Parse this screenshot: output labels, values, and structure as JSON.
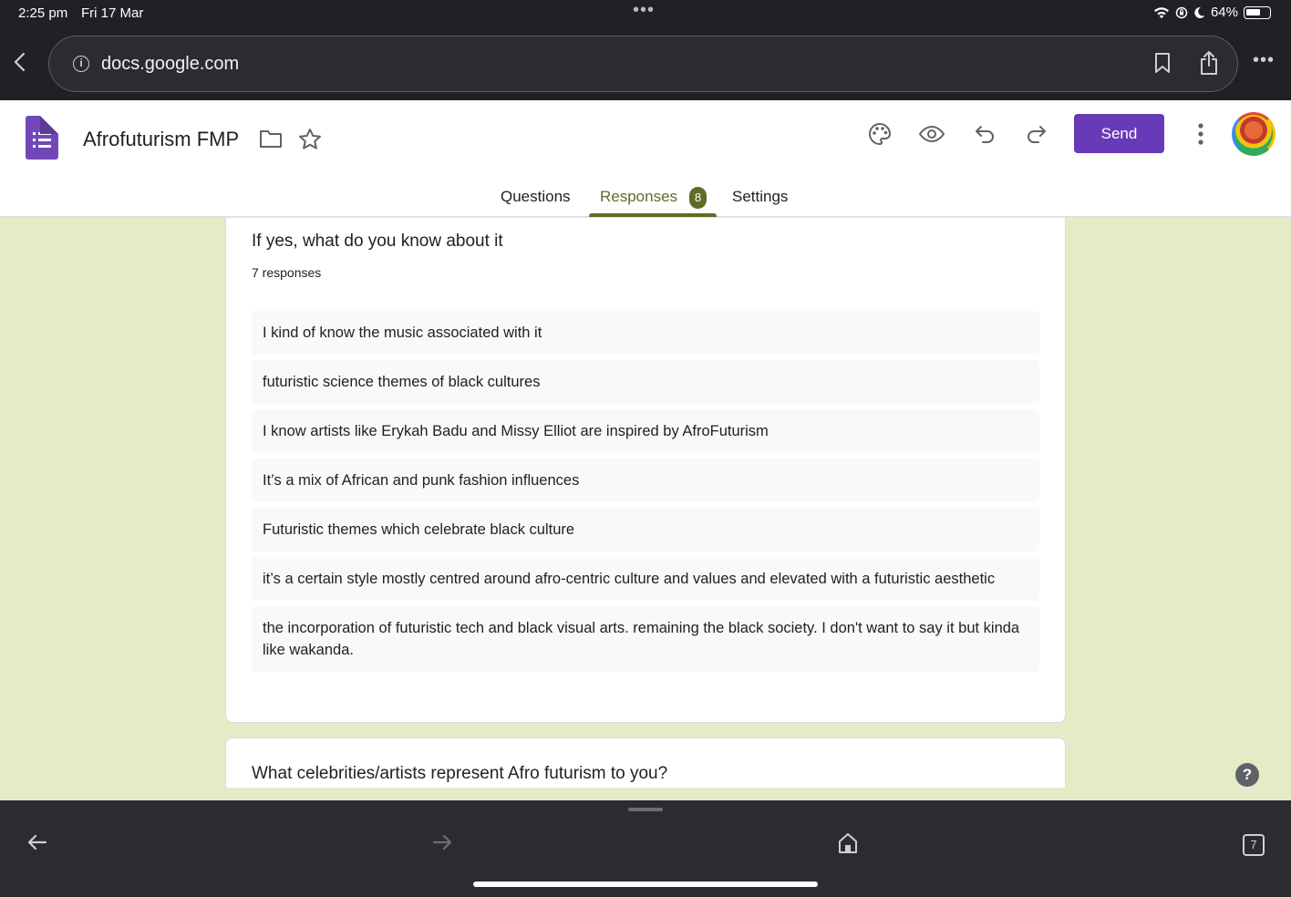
{
  "status": {
    "time": "2:25 pm",
    "date": "Fri 17 Mar",
    "battery": "64%",
    "battery_level": 0.64
  },
  "browser": {
    "url": "docs.google.com",
    "tab_count": "7"
  },
  "form": {
    "title": "Afrofuturism FMP",
    "send_label": "Send",
    "tabs": [
      {
        "label": "Questions"
      },
      {
        "label": "Responses",
        "badge": "8",
        "active": true
      },
      {
        "label": "Settings"
      }
    ]
  },
  "cards": [
    {
      "question": "If yes, what do you know about it",
      "count": "7 responses",
      "responses": [
        "I kind of know the music associated with it",
        "futuristic science themes of black cultures",
        "I know artists like Erykah Badu and Missy Elliot are inspired by AfroFuturism",
        "It’s a mix of African and punk fashion influences",
        "Futuristic themes which celebrate black culture",
        "it’s a certain style mostly centred around afro-centric culture and values and elevated with a futuristic aesthetic",
        "the incorporation of futuristic tech and black visual arts. remaining the black society. I don't want to say it but kinda like wakanda."
      ]
    },
    {
      "question": "What celebrities/artists represent Afro futurism to you?"
    }
  ],
  "help_label": "?",
  "colors": {
    "accent": "#673ab7",
    "tab_active": "#5f6c27",
    "background": "#e6ebc7"
  }
}
